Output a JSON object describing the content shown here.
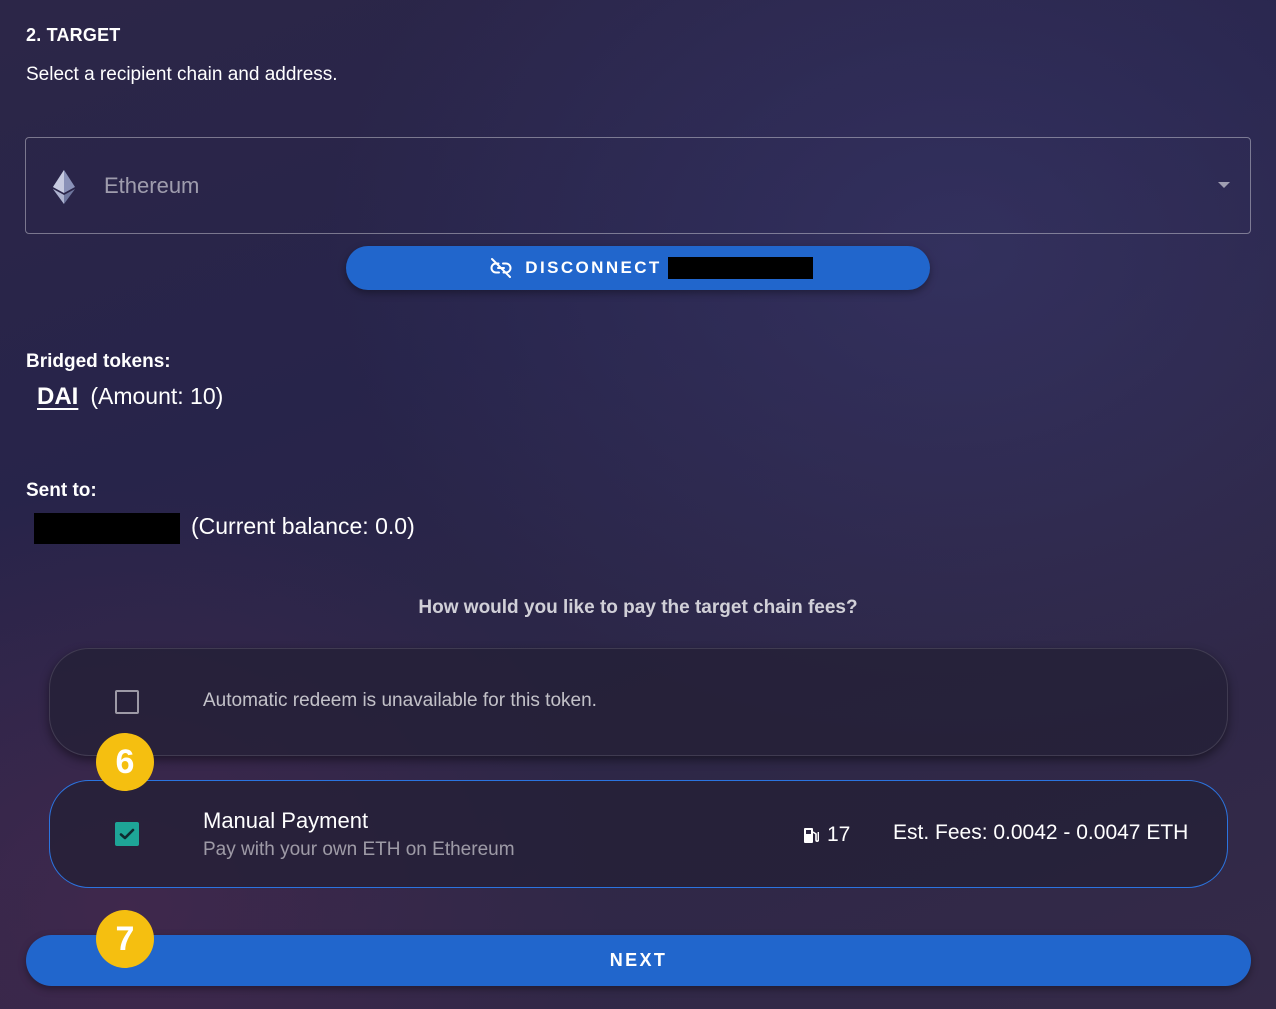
{
  "target": {
    "title": "2. TARGET",
    "subtitle": "Select a recipient chain and address."
  },
  "chain_select": {
    "selected": "Ethereum",
    "icon": "ethereum-icon"
  },
  "wallet": {
    "disconnect_label": "DISCONNECT",
    "icon": "link-off-icon"
  },
  "bridged": {
    "label": "Bridged tokens:",
    "token_symbol": "DAI",
    "amount_text": "(Amount: 10)"
  },
  "recipient": {
    "label": "Sent to:",
    "balance_text": "(Current balance: 0.0)"
  },
  "fees": {
    "question": "How would you like to pay the target chain fees?",
    "options": [
      {
        "text": "Automatic redeem is unavailable for this token.",
        "checked": false
      },
      {
        "title": "Manual Payment",
        "subtitle": "Pay with your own ETH on Ethereum",
        "gas_value": "17",
        "gas_icon": "gas-pump-icon",
        "fees_text": "Est. Fees: 0.0042 - 0.0047 ETH",
        "checked": true
      }
    ]
  },
  "steps": {
    "badge_6": "6",
    "badge_7": "7"
  },
  "next_label": "NEXT",
  "colors": {
    "accent_blue": "#2166cc",
    "checkbox_teal": "#1ea597",
    "badge_yellow": "#f5bf10"
  }
}
